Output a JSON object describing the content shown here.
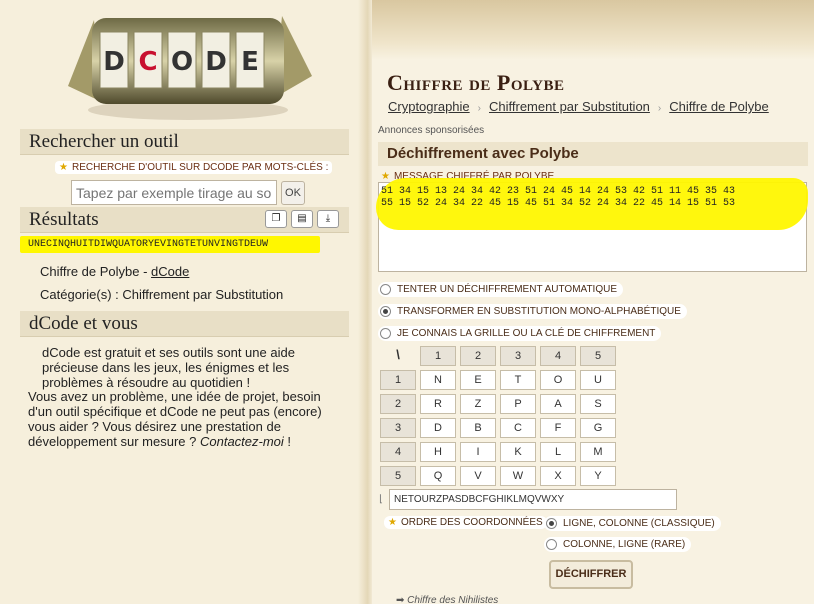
{
  "logo": {
    "letters": [
      "D",
      "C",
      "O",
      "D",
      "E"
    ],
    "accent": "#c8102e"
  },
  "left": {
    "search_heading": "Rechercher un outil",
    "search_label": "RECHERCHE D'OUTIL SUR DCODE PAR MOTS-CLÉS :",
    "search_placeholder": "Tapez par exemple tirage au sort",
    "search_ok": "OK",
    "results_heading": "Résultats",
    "result_text": "UNECINQHUITDIWQUATORYEVINGTETUNVINGTDEUW",
    "result_tool_prefix": "Chiffre de Polybe - ",
    "result_tool_link": "dCode",
    "result_category": "Catégorie(s) : Chiffrement par Substitution",
    "dcode_heading": "dCode et vous",
    "dcode_p1": "dCode est gratuit et ses outils sont une aide précieuse dans les jeux, les énigmes et les problèmes à résoudre au quotidien !",
    "dcode_p2": "Vous avez un problème, une idée de projet, besoin d'un outil spécifique et dCode ne peut pas (encore) vous aider ? Vous désirez une prestation de développement sur mesure ? ",
    "dcode_contact": "Contactez-moi",
    "dcode_end": " !",
    "tool_icons": [
      "copy-icon",
      "print-icon",
      "download-icon"
    ]
  },
  "right": {
    "title": "Chiffre de Polybe",
    "breadcrumb": [
      "Cryptographie",
      "Chiffrement par Substitution",
      "Chiffre de Polybe"
    ],
    "ads": "Annonces sponsorisées",
    "box_title": "Déchiffrement avec Polybe",
    "msg_label": "MESSAGE CHIFFRÉ PAR POLYBE",
    "msg_text": "51 34 15 13 24 34 42 23 51 24 45 14 24 53 42 51 11 45 35 43\n55 15 52 24 34 22 45 15 45 51 34 52 24 34 22 45 14 15 51 53",
    "options": [
      {
        "label": "TENTER UN DÉCHIFFREMENT AUTOMATIQUE",
        "selected": false
      },
      {
        "label": "TRANSFORMER EN SUBSTITUTION MONO-ALPHABÉTIQUE",
        "selected": true
      },
      {
        "label": "JE CONNAIS LA GRILLE OU LA CLÉ DE CHIFFREMENT",
        "selected": false
      }
    ],
    "grid_corner": "\\",
    "grid_cols": [
      "1",
      "2",
      "3",
      "4",
      "5"
    ],
    "grid_rows": [
      "1",
      "2",
      "3",
      "4",
      "5"
    ],
    "grid": [
      [
        "N",
        "E",
        "T",
        "O",
        "U"
      ],
      [
        "R",
        "Z",
        "P",
        "A",
        "S"
      ],
      [
        "D",
        "B",
        "C",
        "F",
        "G"
      ],
      [
        "H",
        "I",
        "K",
        "L",
        "M"
      ],
      [
        "Q",
        "V",
        "W",
        "X",
        "Y"
      ]
    ],
    "key_corner": "⌊",
    "key_value": "NETOURZPASDBCFGHIKLMQVWXY",
    "coord_label": "ORDRE DES COORDONNÉES",
    "coord_options": [
      {
        "label": "LIGNE, COLONNE (CLASSIQUE)",
        "selected": true
      },
      {
        "label": "COLONNE, LIGNE (RARE)",
        "selected": false
      }
    ],
    "decrypt_button": "DÉCHIFFRER",
    "footer_link": "➡ Chiffre des Nihilistes"
  }
}
